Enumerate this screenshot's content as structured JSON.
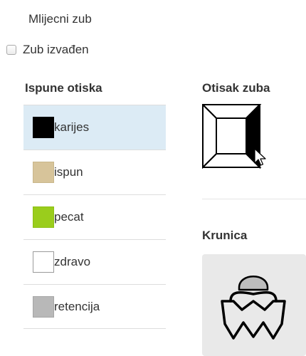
{
  "milk_tooth": {
    "label": "Mlijecni zub"
  },
  "extracted": {
    "label": "Zub izvađen",
    "checked": false
  },
  "fillings": {
    "heading": "Ispune otiska",
    "items": [
      {
        "label": "karijes",
        "color": "#000000",
        "selected": true
      },
      {
        "label": "ispun",
        "color": "#d7c49a",
        "selected": false
      },
      {
        "label": "pecat",
        "color": "#9acd1c",
        "selected": false
      },
      {
        "label": "zdravo",
        "color": "#ffffff",
        "selected": false
      },
      {
        "label": "retencija",
        "color": "#b8b8b8",
        "selected": false
      }
    ]
  },
  "tooth_chart": {
    "heading": "Otisak zuba",
    "icon": "tooth-surface-diagram"
  },
  "crown": {
    "heading": "Krunica",
    "icon": "crown-tooth-icon"
  },
  "colors": {
    "selected_row_bg": "#dcebf5",
    "crown_bg": "#e9e9e9",
    "crown_cap": "#bdbdbd"
  }
}
